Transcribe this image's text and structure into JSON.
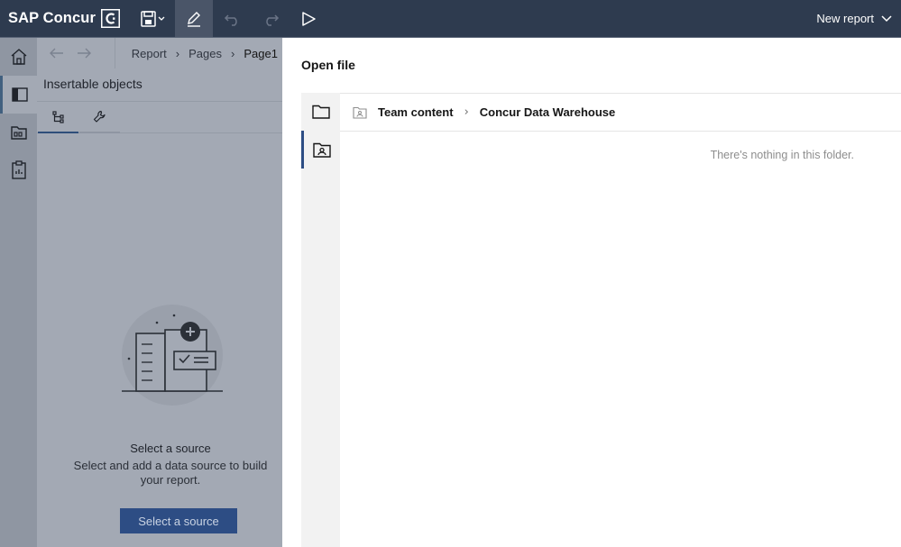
{
  "topbar": {
    "brand": "SAP Concur",
    "new_report_label": "New report",
    "icons": [
      "save-icon",
      "pencil-icon",
      "undo-icon",
      "redo-icon",
      "play-icon",
      "chevron-down-icon"
    ]
  },
  "left_rail": {
    "items": [
      "home-icon",
      "panel-icon",
      "data-folder-icon",
      "clipboard-icon"
    ]
  },
  "left_panel": {
    "breadcrumbs": [
      "Report",
      "Pages",
      "Page1"
    ],
    "title": "Insertable objects",
    "tabs": [
      "hierarchy-icon",
      "wrench-icon"
    ],
    "empty_title": "Select a source",
    "empty_description": "Select and add a data source to build your report.",
    "select_button": "Select a source"
  },
  "dialog": {
    "title": "Open file",
    "rail_items": [
      "folder-icon",
      "team-folder-icon"
    ],
    "breadcrumbs": [
      "Team content",
      "Concur Data Warehouse"
    ],
    "empty_message": "There's nothing in this folder."
  },
  "colors": {
    "topbar": "#2e3b4f",
    "accent": "#2d4d84",
    "overlay": "#a3a9b4"
  }
}
